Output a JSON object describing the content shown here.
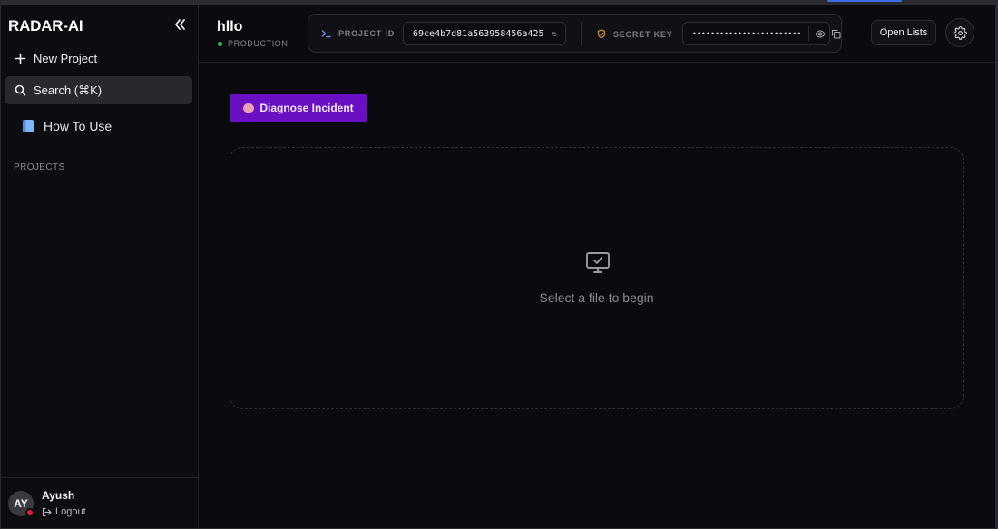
{
  "sidebar": {
    "brand": "RADAR-AI",
    "new_project": "New Project",
    "search": "Search (⌘K)",
    "how_to_use": "How To Use",
    "section_projects": "PROJECTS",
    "user": {
      "initials": "AY",
      "name": "Ayush",
      "logout": "Logout"
    }
  },
  "header": {
    "project_name": "hllo",
    "environment": "PRODUCTION",
    "project_id_label": "PROJECT ID",
    "project_id": "69ce4b7d81a563958456a425",
    "secret_key_label": "SECRET KEY",
    "secret_key_masked": "••••••••••••••••••••••••",
    "open_lists": "Open Lists"
  },
  "main": {
    "diagnose_button": "Diagnose Incident",
    "empty_state": "Select a file to begin"
  },
  "colors": {
    "accent_purple": "#6a10c4",
    "status_green": "#22c55e",
    "avatar_status": "#e11d3a"
  },
  "icons": [
    "collapse-icon",
    "plus-icon",
    "search-icon",
    "book-icon",
    "terminal-icon",
    "copy-icon",
    "shield-icon",
    "eye-icon",
    "gear-icon",
    "brain-icon",
    "monitor-check-icon",
    "logout-icon"
  ]
}
